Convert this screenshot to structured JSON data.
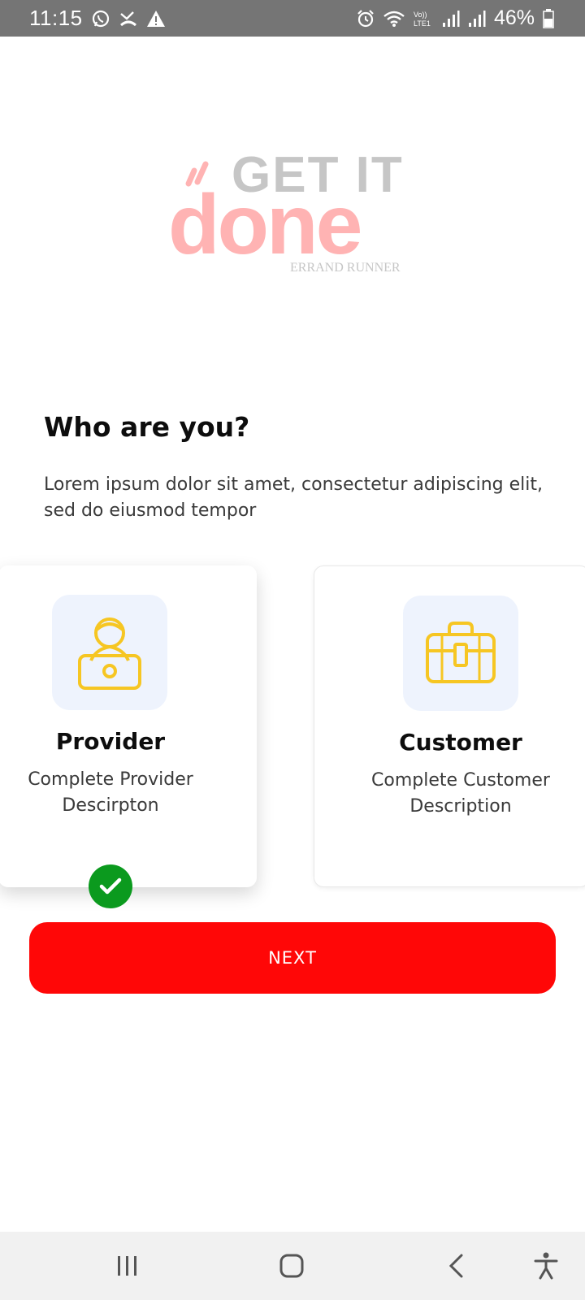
{
  "status_bar": {
    "time": "11:15",
    "battery": "46%",
    "left_icons": [
      "whatsapp-icon",
      "missed-call-icon",
      "warning-icon"
    ],
    "right_icons": [
      "alarm-icon",
      "wifi-icon",
      "volte-icon",
      "signal-icon",
      "signal-icon",
      "battery-icon"
    ]
  },
  "logo": {
    "line1": "GET IT",
    "line2": "done",
    "tagline": "ERRAND RUNNER"
  },
  "page": {
    "title": "Who are you?",
    "subtitle": "Lorem ipsum dolor sit amet, consectetur adipiscing elit, sed do eiusmod tempor"
  },
  "roles": [
    {
      "title": "Provider",
      "desc_line1": "Complete Provider",
      "desc_line2": "Descirpton",
      "icon": "person-laptop-icon",
      "selected": true
    },
    {
      "title": "Customer",
      "desc_line1": "Complete Customer",
      "desc_line2": "Description",
      "icon": "briefcase-icon",
      "selected": false
    }
  ],
  "next_button": {
    "label": "NEXT"
  },
  "colors": {
    "primary": "#ff0707",
    "check": "#0b9a1e",
    "icon_yellow": "#f6c623",
    "icon_bg": "#eef3fd",
    "logo_pink": "#ffb3b3",
    "logo_gray": "#c6c6c6"
  },
  "nav_bar": {
    "items": [
      "recents-icon",
      "home-icon",
      "back-icon",
      "accessibility-icon"
    ]
  }
}
